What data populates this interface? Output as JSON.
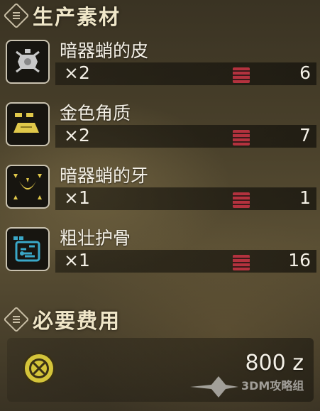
{
  "sections": {
    "materials_title": "生产素材",
    "cost_title": "必要费用"
  },
  "items": [
    {
      "name": "暗器蛸的皮",
      "qty": "×2",
      "owned": "6",
      "icon": "hide-material-icon",
      "icon_color": "#c8c8c8"
    },
    {
      "name": "金色角质",
      "qty": "×2",
      "owned": "7",
      "icon": "gold-ingot-icon",
      "icon_color": "#e0c84a"
    },
    {
      "name": "暗器蛸的牙",
      "qty": "×1",
      "owned": "1",
      "icon": "fang-material-icon",
      "icon_color": "#e0c84a"
    },
    {
      "name": "粗壮护骨",
      "qty": "×1",
      "owned": "16",
      "icon": "bone-material-icon",
      "icon_color": "#3aa8c8"
    }
  ],
  "cost": {
    "value": "800",
    "unit": "z",
    "icon": "zenny-coin-icon"
  },
  "watermark": {
    "text": "3DM攻略组"
  },
  "colors": {
    "box_icon": "#b3323e",
    "header_text": "#efe6c8"
  }
}
